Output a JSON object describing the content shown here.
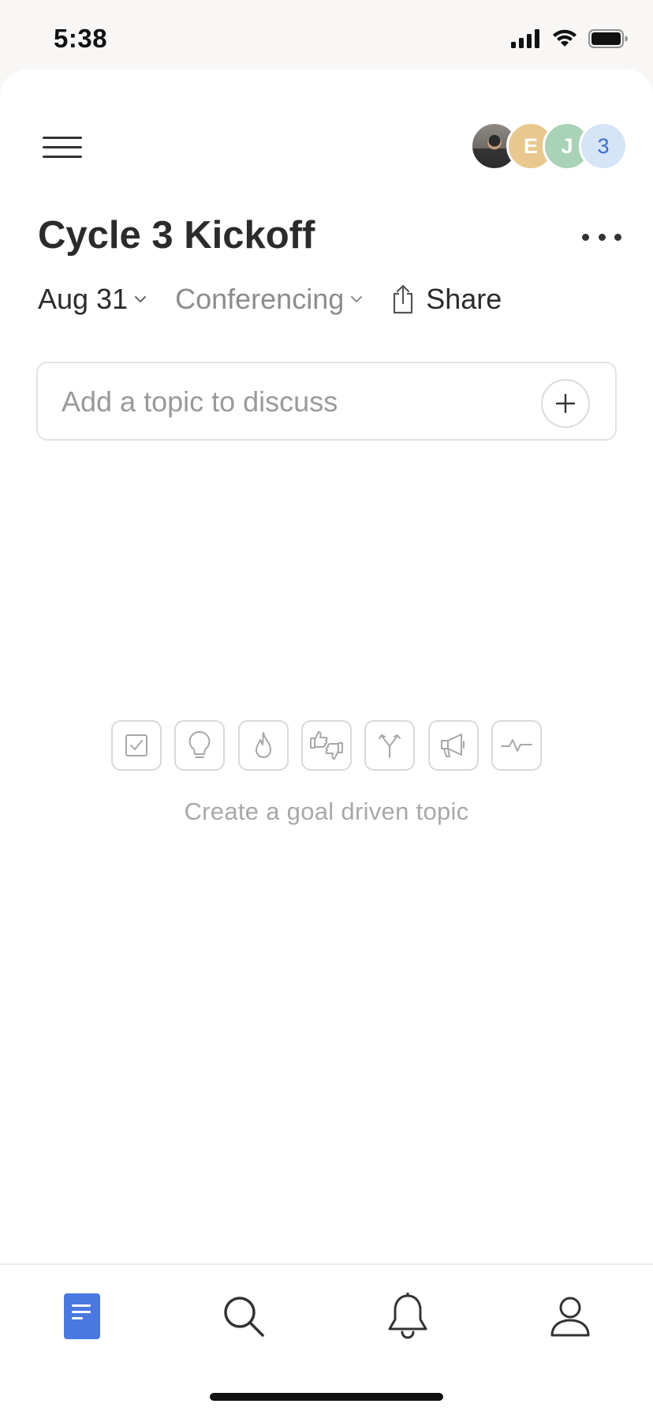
{
  "status_bar": {
    "time": "5:38"
  },
  "header": {
    "avatars": [
      {
        "type": "photo",
        "initial": ""
      },
      {
        "type": "initial",
        "initial": "E",
        "color": "#e8c88f"
      },
      {
        "type": "initial",
        "initial": "J",
        "color": "#a9d2b7"
      },
      {
        "type": "count",
        "initial": "3",
        "color": "#d6e4f7",
        "text_color": "#3b6fd1"
      }
    ]
  },
  "meeting": {
    "title": "Cycle 3 Kickoff",
    "date": "Aug 31",
    "conferencing": "Conferencing",
    "share": "Share"
  },
  "topic_input": {
    "placeholder": "Add a topic to discuss"
  },
  "goal_topics": {
    "icons": [
      "checkbox-icon",
      "lightbulb-icon",
      "flame-icon",
      "thumbs-up-down-icon",
      "fork-icon",
      "megaphone-icon",
      "pulse-icon"
    ],
    "caption": "Create a goal driven topic"
  },
  "tabbar": {
    "tabs": [
      "notes-tab",
      "search-tab",
      "notifications-tab",
      "profile-tab"
    ],
    "active_color": "#4a78e0"
  }
}
